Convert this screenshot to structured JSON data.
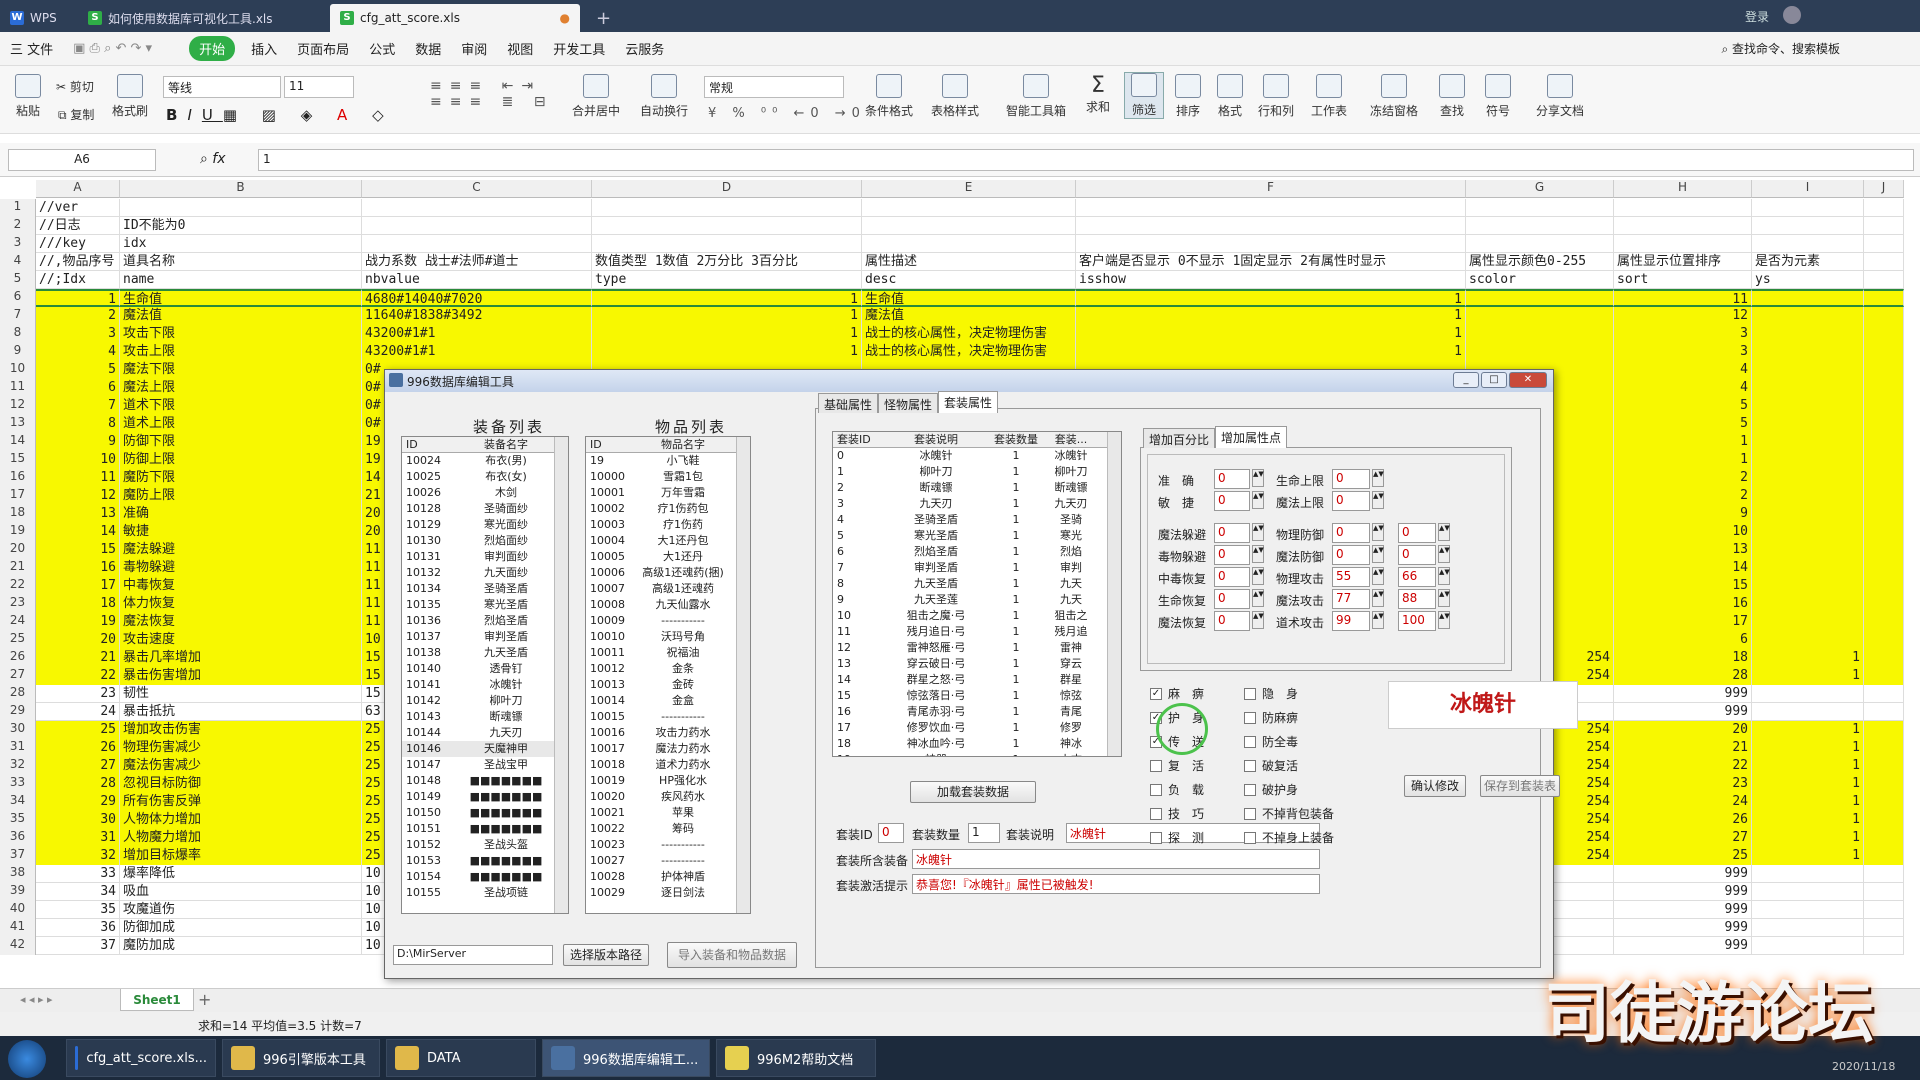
{
  "tabs": [
    {
      "label": "WPS"
    },
    {
      "label": "如何使用数据库可视化工具.xls"
    },
    {
      "label": "cfg_att_score.xls"
    }
  ],
  "login": "登录",
  "menu": [
    "三 文件",
    "开始",
    "插入",
    "页面布局",
    "公式",
    "数据",
    "审阅",
    "视图",
    "开发工具",
    "云服务"
  ],
  "search_cmd": "查找命令、搜索模板",
  "ribbon": {
    "paste": "粘贴",
    "cut": "剪切",
    "copy": "复制",
    "fmt": "格式刷",
    "font": "等线",
    "size": "11",
    "numfmt": "常规",
    "merge": "合并居中",
    "wrap": "自动换行",
    "cond": "条件格式",
    "tblstyle": "表格样式",
    "smart": "智能工具箱",
    "sum": "求和",
    "filter": "筛选",
    "sort": "排序",
    "format": "格式",
    "rowcol": "行和列",
    "sheet": "工作表",
    "freeze": "冻结窗格",
    "find": "查找",
    "symbol": "符号",
    "share": "分享文档"
  },
  "namebox": "A6",
  "formula": "1",
  "columns": [
    "A",
    "B",
    "C",
    "D",
    "E",
    "F",
    "G",
    "H",
    "I",
    "J"
  ],
  "rows": [
    [
      "1",
      "//ver",
      "",
      "",
      "",
      "",
      "",
      "",
      "",
      "",
      ""
    ],
    [
      "2",
      "//日志",
      "ID不能为0",
      "",
      "",
      "",
      "",
      "",
      "",
      "",
      ""
    ],
    [
      "3",
      "///key",
      "idx",
      "",
      "",
      "",
      "",
      "",
      "",
      "",
      ""
    ],
    [
      "4",
      "//,物品序号",
      "道具名称",
      "战力系数 战士#法师#道士",
      "数值类型 1数值 2万分比 3百分比",
      "属性描述",
      "客户端是否显示 0不显示 1固定显示 2有属性时显示",
      "属性显示颜色0-255",
      "属性显示位置排序",
      "是否为元素",
      ""
    ],
    [
      "5",
      "//;Idx",
      "name",
      "nbvalue",
      "type",
      "desc",
      "isshow",
      "scolor",
      "sort",
      "ys",
      ""
    ],
    [
      "6",
      "1",
      "生命值",
      "4680#14040#7020",
      "1",
      "生命值",
      "1",
      "",
      "11",
      "",
      ""
    ],
    [
      "7",
      "2",
      "魔法值",
      "11640#1838#3492",
      "1",
      "魔法值",
      "1",
      "",
      "12",
      "",
      ""
    ],
    [
      "8",
      "3",
      "攻击下限",
      "43200#1#1",
      "1",
      "战士的核心属性，决定物理伤害",
      "1",
      "",
      "3",
      "",
      ""
    ],
    [
      "9",
      "4",
      "攻击上限",
      "43200#1#1",
      "1",
      "战士的核心属性，决定物理伤害",
      "1",
      "",
      "3",
      "",
      ""
    ],
    [
      "10",
      "5",
      "魔法下限",
      "0#",
      "",
      "",
      "",
      "",
      "4",
      "",
      ""
    ],
    [
      "11",
      "6",
      "魔法上限",
      "0#",
      "",
      "",
      "",
      "",
      "4",
      "",
      ""
    ],
    [
      "12",
      "7",
      "道术下限",
      "0#",
      "",
      "",
      "",
      "",
      "5",
      "",
      ""
    ],
    [
      "13",
      "8",
      "道术上限",
      "0#",
      "",
      "",
      "",
      "",
      "5",
      "",
      ""
    ],
    [
      "14",
      "9",
      "防御下限",
      "19",
      "",
      "",
      "",
      "",
      "1",
      "",
      ""
    ],
    [
      "15",
      "10",
      "防御上限",
      "19",
      "",
      "",
      "",
      "",
      "1",
      "",
      ""
    ],
    [
      "16",
      "11",
      "魔防下限",
      "14",
      "",
      "",
      "",
      "",
      "2",
      "",
      ""
    ],
    [
      "17",
      "12",
      "魔防上限",
      "21",
      "",
      "",
      "",
      "",
      "2",
      "",
      ""
    ],
    [
      "18",
      "13",
      "准确",
      "20",
      "",
      "",
      "",
      "",
      "9",
      "",
      ""
    ],
    [
      "19",
      "14",
      "敏捷",
      "20",
      "",
      "",
      "",
      "",
      "10",
      "",
      ""
    ],
    [
      "20",
      "15",
      "魔法躲避",
      "11",
      "",
      "",
      "",
      "",
      "13",
      "",
      ""
    ],
    [
      "21",
      "16",
      "毒物躲避",
      "11",
      "",
      "",
      "",
      "",
      "14",
      "",
      ""
    ],
    [
      "22",
      "17",
      "中毒恢复",
      "11",
      "",
      "",
      "",
      "",
      "15",
      "",
      ""
    ],
    [
      "23",
      "18",
      "体力恢复",
      "11",
      "",
      "",
      "",
      "",
      "16",
      "",
      ""
    ],
    [
      "24",
      "19",
      "魔法恢复",
      "11",
      "",
      "",
      "",
      "",
      "17",
      "",
      ""
    ],
    [
      "25",
      "20",
      "攻击速度",
      "10",
      "",
      "",
      "",
      "",
      "6",
      "",
      ""
    ],
    [
      "26",
      "21",
      "暴击几率增加",
      "15",
      "",
      "",
      "",
      "254",
      "18",
      "1",
      ""
    ],
    [
      "27",
      "22",
      "暴击伤害增加",
      "15",
      "",
      "",
      "",
      "254",
      "28",
      "1",
      ""
    ],
    [
      "28",
      "23",
      "韧性",
      "15",
      "",
      "",
      "",
      "",
      "999",
      "",
      ""
    ],
    [
      "29",
      "24",
      "暴击抵抗",
      "63",
      "",
      "",
      "",
      "",
      "999",
      "",
      ""
    ],
    [
      "30",
      "25",
      "增加攻击伤害",
      "25",
      "",
      "",
      "",
      "254",
      "20",
      "1",
      ""
    ],
    [
      "31",
      "26",
      "物理伤害减少",
      "25",
      "",
      "",
      "",
      "254",
      "21",
      "1",
      ""
    ],
    [
      "32",
      "27",
      "魔法伤害减少",
      "25",
      "",
      "",
      "",
      "254",
      "22",
      "1",
      ""
    ],
    [
      "33",
      "28",
      "忽视目标防御",
      "25",
      "",
      "",
      "",
      "254",
      "23",
      "1",
      ""
    ],
    [
      "34",
      "29",
      "所有伤害反弹",
      "25",
      "",
      "",
      "",
      "254",
      "24",
      "1",
      ""
    ],
    [
      "35",
      "30",
      "人物体力增加",
      "25",
      "",
      "",
      "",
      "254",
      "26",
      "1",
      ""
    ],
    [
      "36",
      "31",
      "人物魔力增加",
      "25",
      "",
      "",
      "",
      "254",
      "27",
      "1",
      ""
    ],
    [
      "37",
      "32",
      "增加目标爆率",
      "25",
      "",
      "",
      "",
      "254",
      "25",
      "1",
      ""
    ],
    [
      "38",
      "33",
      "爆率降低",
      "10",
      "",
      "",
      "",
      "",
      "999",
      "",
      ""
    ],
    [
      "39",
      "34",
      "吸血",
      "10",
      "",
      "",
      "",
      "",
      "999",
      "",
      ""
    ],
    [
      "40",
      "35",
      "攻魔道伤",
      "10",
      "",
      "",
      "",
      "",
      "999",
      "",
      ""
    ],
    [
      "41",
      "36",
      "防御加成",
      "10",
      "",
      "",
      "",
      "",
      "999",
      "",
      ""
    ],
    [
      "42",
      "37",
      "魔防加成",
      "10",
      "",
      "",
      "",
      "",
      "999",
      "",
      ""
    ]
  ],
  "yellow_rows": [
    6,
    7,
    8,
    9,
    10,
    11,
    12,
    13,
    14,
    15,
    16,
    17,
    18,
    19,
    20,
    21,
    22,
    23,
    24,
    25,
    26,
    27,
    30,
    31,
    32,
    33,
    34,
    35,
    36,
    37
  ],
  "sheet_tab": "Sheet1",
  "status_text": "求和=14  平均值=3.5  计数=7",
  "taskbar": [
    {
      "label": "cfg_att_score.xls..."
    },
    {
      "label": "996引擎版本工具"
    },
    {
      "label": "DATA"
    },
    {
      "label": "996数据库编辑工..."
    },
    {
      "label": "996M2帮助文档"
    }
  ],
  "clock_date": "2020/11/18",
  "dialog": {
    "title": "996数据库编辑工具",
    "equip_title": "装备列表",
    "item_title": "物品列表",
    "equip_hdr": [
      "ID",
      "装备名字"
    ],
    "equip": [
      [
        "10024",
        "布衣(男)"
      ],
      [
        "10025",
        "布衣(女)"
      ],
      [
        "10026",
        "木剑"
      ],
      [
        "10128",
        "圣骑面纱"
      ],
      [
        "10129",
        "寒光面纱"
      ],
      [
        "10130",
        "烈焰面纱"
      ],
      [
        "10131",
        "审判面纱"
      ],
      [
        "10132",
        "九天面纱"
      ],
      [
        "10134",
        "圣骑圣盾"
      ],
      [
        "10135",
        "寒光圣盾"
      ],
      [
        "10136",
        "烈焰圣盾"
      ],
      [
        "10137",
        "审判圣盾"
      ],
      [
        "10138",
        "九天圣盾"
      ],
      [
        "10140",
        "透骨钉"
      ],
      [
        "10141",
        "冰魄针"
      ],
      [
        "10142",
        "柳叶刀"
      ],
      [
        "10143",
        "断魂镖"
      ],
      [
        "10144",
        "九天刃"
      ],
      [
        "10146",
        "天魔神甲"
      ],
      [
        "10147",
        "圣战宝甲"
      ],
      [
        "10148",
        "■■■■■■■"
      ],
      [
        "10149",
        "■■■■■■■"
      ],
      [
        "10150",
        "■■■■■■■"
      ],
      [
        "10151",
        "■■■■■■■"
      ],
      [
        "10152",
        "圣战头盔"
      ],
      [
        "10153",
        "■■■■■■■"
      ],
      [
        "10154",
        "■■■■■■■"
      ],
      [
        "10155",
        "圣战项链"
      ]
    ],
    "item_hdr": [
      "ID",
      "物品名字"
    ],
    "items": [
      [
        "19",
        "小飞鞋"
      ],
      [
        "10000",
        "雪霜1包"
      ],
      [
        "10001",
        "万年雪霜"
      ],
      [
        "10002",
        "疗1伤药包"
      ],
      [
        "10003",
        "疗1伤药"
      ],
      [
        "10004",
        "大1还丹包"
      ],
      [
        "10005",
        "大1还丹"
      ],
      [
        "10006",
        "高级1还魂药(捆)"
      ],
      [
        "10007",
        "高级1还魂药"
      ],
      [
        "10008",
        "九天仙露水"
      ],
      [
        "10009",
        "-----------"
      ],
      [
        "10010",
        "沃玛号角"
      ],
      [
        "10011",
        "祝福油"
      ],
      [
        "10012",
        "金条"
      ],
      [
        "10013",
        "金砖"
      ],
      [
        "10014",
        "金盒"
      ],
      [
        "10015",
        "-----------"
      ],
      [
        "10016",
        "攻击力药水"
      ],
      [
        "10017",
        "魔法力药水"
      ],
      [
        "10018",
        "道术力药水"
      ],
      [
        "10019",
        "HP强化水"
      ],
      [
        "10020",
        "疾风药水"
      ],
      [
        "10021",
        "苹果"
      ],
      [
        "10022",
        "筹码"
      ],
      [
        "10023",
        "-----------"
      ],
      [
        "10027",
        "-----------"
      ],
      [
        "10028",
        "护体神盾"
      ],
      [
        "10029",
        "逐日剑法"
      ]
    ],
    "path": "D:\\MirServer",
    "btn_path": "选择版本路径",
    "btn_import": "导入装备和物品数据",
    "tabs": [
      "基础属性",
      "怪物属性",
      "套装属性"
    ],
    "suit_hdr": [
      "套装ID",
      "套装说明",
      "套装数量",
      "套装..."
    ],
    "suits": [
      [
        "0",
        "冰魄针",
        "1",
        "冰魄针"
      ],
      [
        "1",
        "柳叶刀",
        "1",
        "柳叶刀"
      ],
      [
        "2",
        "断魂镖",
        "1",
        "断魂镖"
      ],
      [
        "3",
        "九天刃",
        "1",
        "九天刃"
      ],
      [
        "4",
        "圣骑圣盾",
        "1",
        "圣骑"
      ],
      [
        "5",
        "寒光圣盾",
        "1",
        "寒光"
      ],
      [
        "6",
        "烈焰圣盾",
        "1",
        "烈焰"
      ],
      [
        "7",
        "审判圣盾",
        "1",
        "审判"
      ],
      [
        "8",
        "九天圣盾",
        "1",
        "九天"
      ],
      [
        "9",
        "九天圣莲",
        "1",
        "九天"
      ],
      [
        "10",
        "狙击之魔·弓",
        "1",
        "狙击之"
      ],
      [
        "11",
        "残月追日·弓",
        "1",
        "残月追"
      ],
      [
        "12",
        "雷神怒雁·弓",
        "1",
        "雷神"
      ],
      [
        "13",
        "穿云破日·弓",
        "1",
        "穿云"
      ],
      [
        "14",
        "群星之怒·弓",
        "1",
        "群星"
      ],
      [
        "15",
        "惊弦落日·弓",
        "1",
        "惊弦"
      ],
      [
        "16",
        "青尾赤羽·弓",
        "1",
        "青尾"
      ],
      [
        "17",
        "修罗饮血·弓",
        "1",
        "修罗"
      ],
      [
        "18",
        "神冰血吟·弓",
        "1",
        "神冰"
      ],
      [
        "19",
        "神器",
        "1",
        "上古"
      ],
      [
        "20",
        "神器",
        "1",
        "上古"
      ]
    ],
    "btn_load": "加载套装数据",
    "suit_id_l": "套装ID",
    "suit_id": "0",
    "suit_cnt_l": "套装数量",
    "suit_cnt": "1",
    "suit_desc_l": "套装说明",
    "suit_desc": "冰魄针",
    "suit_eq_l": "套装所含装备",
    "suit_eq": "冰魄针",
    "suit_tip_l": "套装激活提示",
    "suit_tip": "恭喜您!『冰魄针』属性已被触发!",
    "subtabs": [
      "增加百分比",
      "增加属性点"
    ],
    "attrs_l": [
      [
        "准　确",
        "0"
      ],
      [
        "敏　捷",
        "0"
      ],
      [
        "魔法躲避",
        "0"
      ],
      [
        "毒物躲避",
        "0"
      ],
      [
        "中毒恢复",
        "0"
      ],
      [
        "生命恢复",
        "0"
      ],
      [
        "魔法恢复",
        "0"
      ]
    ],
    "attrs_r": [
      [
        "生命上限",
        "0",
        ""
      ],
      [
        "魔法上限",
        "0",
        ""
      ],
      [
        "物理防御",
        "0",
        "0"
      ],
      [
        "魔法防御",
        "0",
        "0"
      ],
      [
        "物理攻击",
        "55",
        "66"
      ],
      [
        "魔法攻击",
        "77",
        "88"
      ],
      [
        "道术攻击",
        "99",
        "100"
      ]
    ],
    "checks_l": [
      [
        "麻　痹",
        true
      ],
      [
        "护　身",
        true
      ],
      [
        "传　送",
        true
      ],
      [
        "复　活",
        false
      ],
      [
        "负　载",
        false
      ],
      [
        "技　巧",
        false
      ],
      [
        "探　测",
        false
      ]
    ],
    "checks_r": [
      [
        "隐　身",
        false
      ],
      [
        "防麻痹",
        false
      ],
      [
        "防全毒",
        false
      ],
      [
        "破复活",
        false
      ],
      [
        "破护身",
        false
      ],
      [
        "不掉背包装备",
        false
      ],
      [
        "不掉身上装备",
        false
      ]
    ],
    "preview": "冰魄针",
    "btn_confirm": "确认修改",
    "btn_save": "保存到套装表"
  },
  "watermark": "司徒游论坛"
}
